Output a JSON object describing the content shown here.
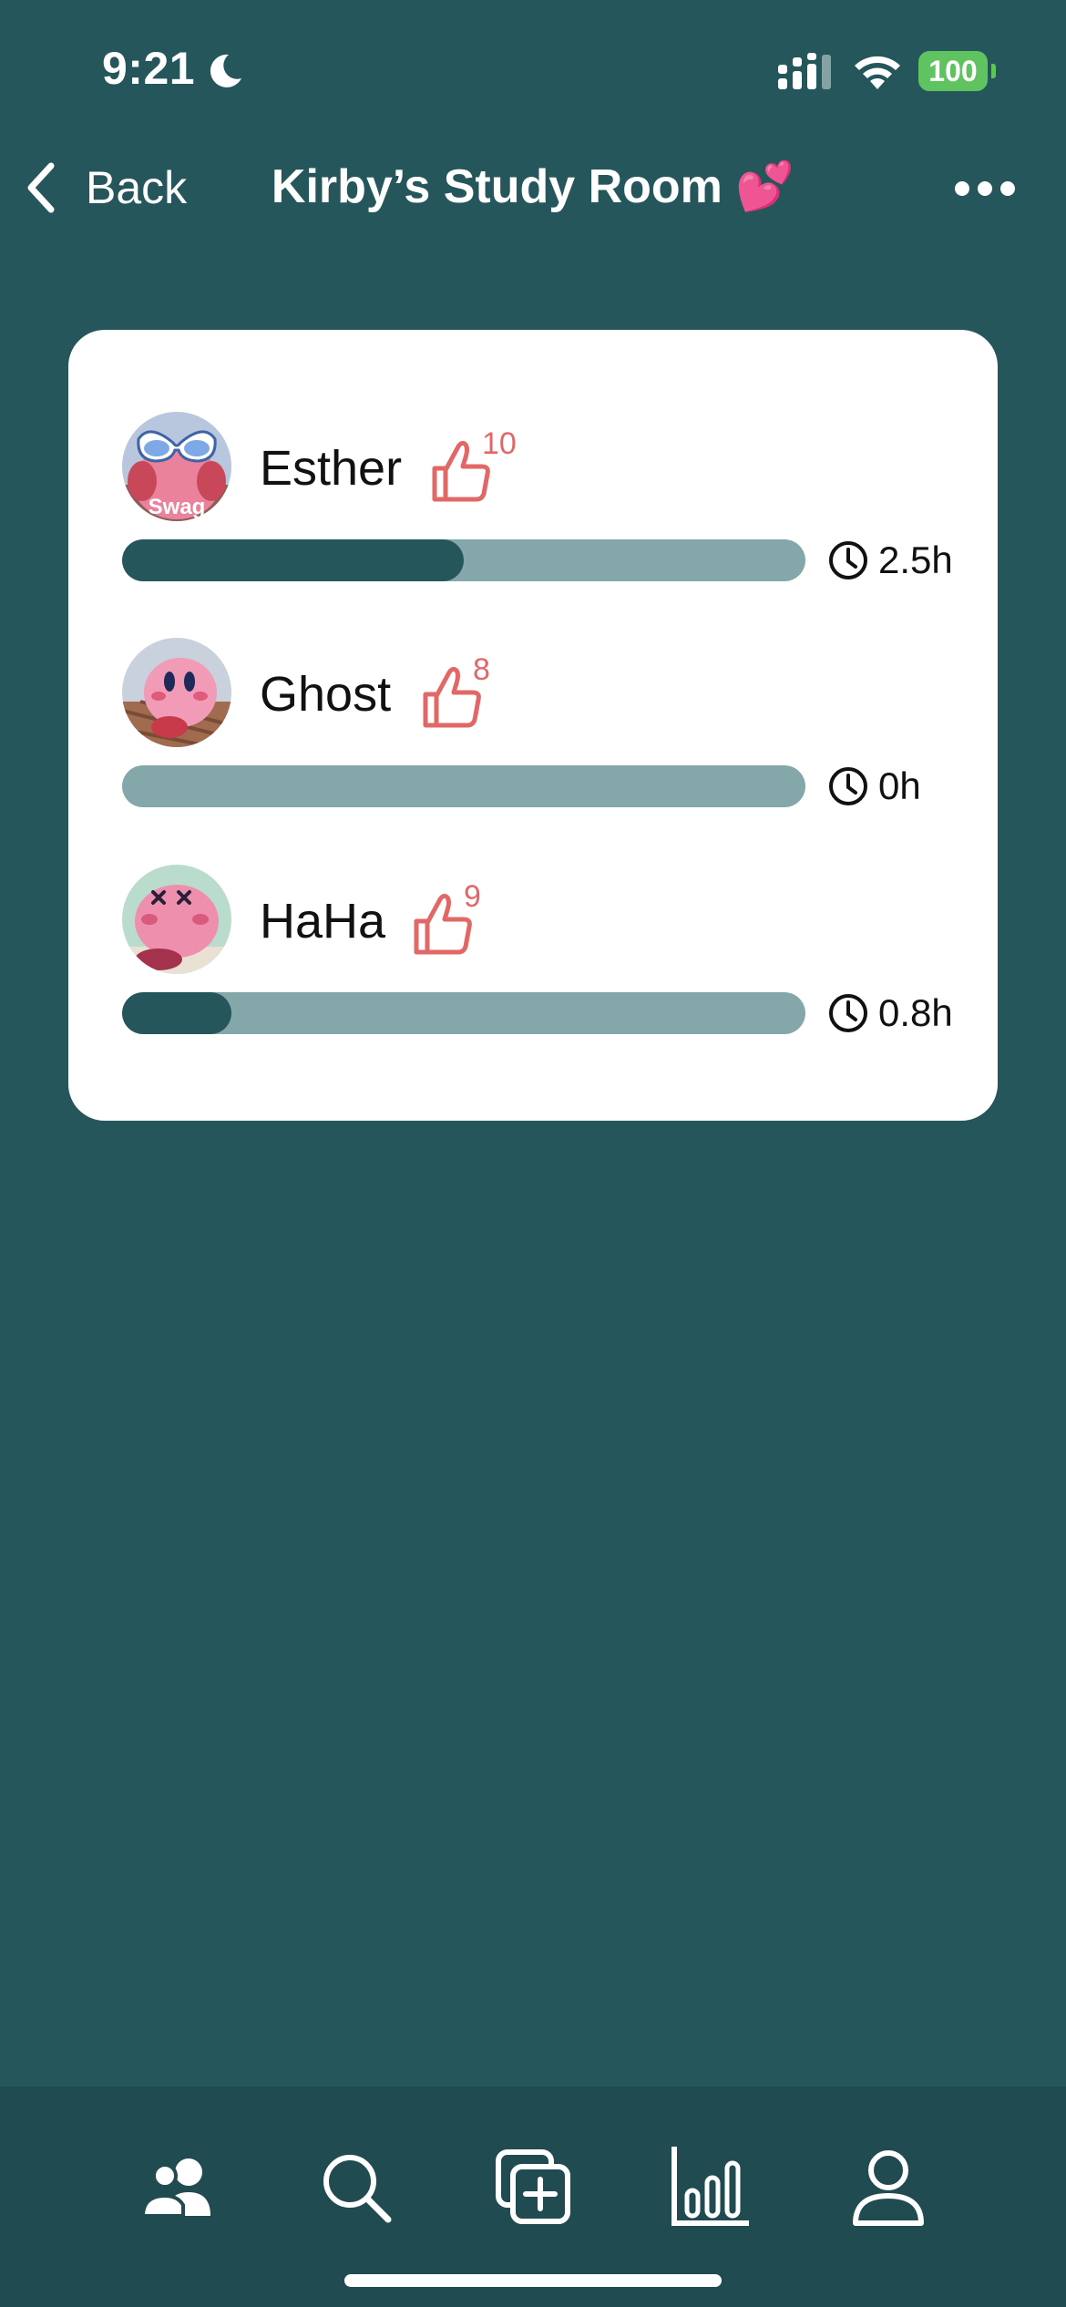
{
  "status_bar": {
    "time": "9:21",
    "focus_icon": "moon-icon",
    "signal_icon": "cellular-signal-icon",
    "wifi_icon": "wifi-icon",
    "battery_level": "100",
    "battery_color": "#5fc45f"
  },
  "nav": {
    "back_label": "Back",
    "title": "Kirby’s Study Room 💕",
    "more_icon": "more-horizontal-icon"
  },
  "members": [
    {
      "name": "Esther",
      "likes": "10",
      "hours": "2.5h",
      "progress": 0.5,
      "avatar": "kirby-sunglasses-avatar",
      "avatar_caption": "Swag"
    },
    {
      "name": "Ghost",
      "likes": "8",
      "hours": "0h",
      "progress": 0,
      "avatar": "kirby-basket-avatar"
    },
    {
      "name": "HaHa",
      "likes": "9",
      "hours": "0.8h",
      "progress": 0.16,
      "avatar": "kirby-dizzy-avatar"
    }
  ],
  "tabs": [
    {
      "name": "friends",
      "icon": "people-icon",
      "selected": true
    },
    {
      "name": "search",
      "icon": "search-icon"
    },
    {
      "name": "add",
      "icon": "add-copy-icon"
    },
    {
      "name": "stats",
      "icon": "bar-chart-icon"
    },
    {
      "name": "profile",
      "icon": "person-icon"
    }
  ],
  "colors": {
    "background": "#25565c",
    "card": "#ffffff",
    "progress_track": "#84a8aa",
    "progress_fill": "#25565c",
    "like_accent": "#e26868",
    "tab_bar": "#1f4b51"
  }
}
